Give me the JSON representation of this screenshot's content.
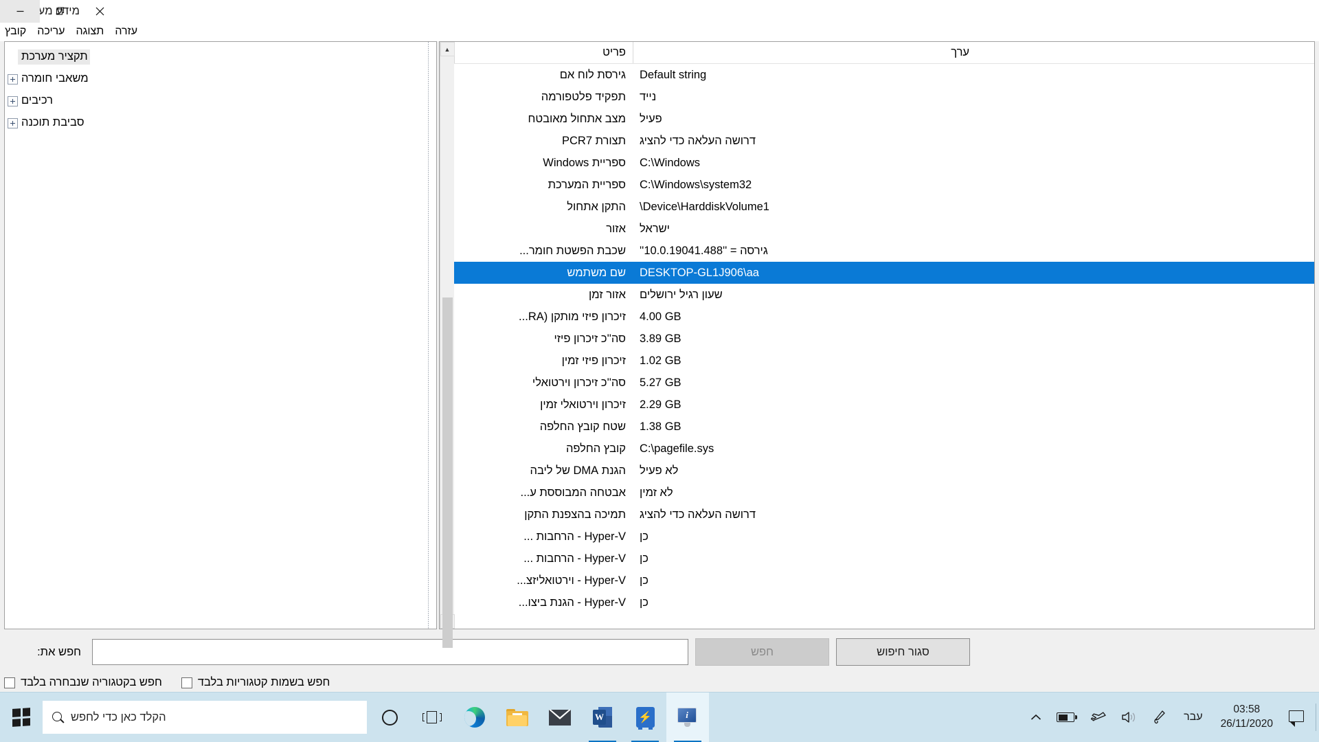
{
  "window": {
    "title": "מידע מערכת",
    "icon": "system-information-icon",
    "controls": {
      "minimize": "–",
      "maximize": "❐",
      "close": "✕"
    }
  },
  "menubar": {
    "items": [
      {
        "label": "קובץ"
      },
      {
        "label": "עריכה"
      },
      {
        "label": "תצוגה"
      },
      {
        "label": "עזרה"
      }
    ]
  },
  "tree": {
    "items": [
      {
        "label": "תקציר מערכת",
        "expandable": false,
        "selected": true
      },
      {
        "label": "משאבי חומרה",
        "expandable": true,
        "selected": false
      },
      {
        "label": "רכיבים",
        "expandable": true,
        "selected": false
      },
      {
        "label": "סביבת תוכנה",
        "expandable": true,
        "selected": false
      }
    ]
  },
  "detail": {
    "headers": {
      "item": "פריט",
      "value": "ערך"
    },
    "rows": [
      {
        "item": "גירסת לוח אם",
        "value": "Default string",
        "dir": "ltr",
        "selected": false
      },
      {
        "item": "תפקיד פלטפורמה",
        "value": "נייד",
        "dir": "rtl",
        "selected": false
      },
      {
        "item": "מצב אתחול מאובטח",
        "value": "פעיל",
        "dir": "rtl",
        "selected": false
      },
      {
        "item": "תצורת PCR7",
        "value": "דרושה העלאה כדי להציג",
        "dir": "rtl",
        "selected": false
      },
      {
        "item": "ספריית Windows",
        "value": "C:\\Windows",
        "dir": "ltr",
        "selected": false
      },
      {
        "item": "ספריית המערכת",
        "value": "C:\\Windows\\system32",
        "dir": "ltr",
        "selected": false
      },
      {
        "item": "התקן אתחול",
        "value": "\\Device\\HarddiskVolume1",
        "dir": "ltr",
        "selected": false
      },
      {
        "item": "אזור",
        "value": "ישראל",
        "dir": "rtl",
        "selected": false
      },
      {
        "item": "שכבת הפשטת חומר...",
        "value": "גירסה = ''10.0.19041.488''",
        "dir": "rtl",
        "selected": false
      },
      {
        "item": "שם משתמש",
        "value": "DESKTOP-GL1J906\\aa",
        "dir": "ltr",
        "selected": true
      },
      {
        "item": "אזור זמן",
        "value": "שעון רגיל ירושלים",
        "dir": "rtl",
        "selected": false
      },
      {
        "item": "זיכרון פיזי מותקן (RA...",
        "value": "4.00 GB",
        "dir": "ltr",
        "selected": false
      },
      {
        "item": "סה''כ זיכרון פיזי",
        "value": "3.89 GB",
        "dir": "ltr",
        "selected": false
      },
      {
        "item": "זיכרון פיזי זמין",
        "value": "1.02 GB",
        "dir": "ltr",
        "selected": false
      },
      {
        "item": "סה''כ זיכרון וירטואלי",
        "value": "5.27 GB",
        "dir": "ltr",
        "selected": false
      },
      {
        "item": "זיכרון וירטואלי זמין",
        "value": "2.29 GB",
        "dir": "ltr",
        "selected": false
      },
      {
        "item": "שטח קובץ החלפה",
        "value": "1.38 GB",
        "dir": "ltr",
        "selected": false
      },
      {
        "item": "קובץ החלפה",
        "value": "C:\\pagefile.sys",
        "dir": "ltr",
        "selected": false
      },
      {
        "item": "הגנת DMA של ליבה",
        "value": "לא פעיל",
        "dir": "rtl",
        "selected": false
      },
      {
        "item": "אבטחה המבוססת ע...",
        "value": "לא זמין",
        "dir": "rtl",
        "selected": false
      },
      {
        "item": "תמיכה בהצפנת התקן",
        "value": "דרושה העלאה כדי להציג",
        "dir": "rtl",
        "selected": false
      },
      {
        "item": "Hyper-V - הרחבות ...",
        "value": "כן",
        "dir": "rtl",
        "selected": false
      },
      {
        "item": "Hyper-V - הרחבות ...",
        "value": "כן",
        "dir": "rtl",
        "selected": false
      },
      {
        "item": "Hyper-V - וירטואליזצ...",
        "value": "כן",
        "dir": "rtl",
        "selected": false
      },
      {
        "item": "Hyper-V - הגנת ביצו...",
        "value": "כן",
        "dir": "rtl",
        "selected": false
      }
    ]
  },
  "search": {
    "label": "חפש את:",
    "input_value": "",
    "input_placeholder": "",
    "find_button": "חפש",
    "close_button": "סגור חיפוש",
    "checkbox_selected_category": "חפש בקטגוריה שנבחרה בלבד",
    "checkbox_category_names": "חפש בשמות קטגוריות בלבד"
  },
  "taskbar": {
    "start_icon": "windows-logo-icon",
    "search_placeholder": "הקלד כאן כדי לחפש",
    "search_icon": "search-icon",
    "items": [
      {
        "name": "cortana-icon",
        "label": "Cortana"
      },
      {
        "name": "task-view-icon",
        "label": "תצוגת משימות"
      },
      {
        "name": "edge-icon",
        "label": "Microsoft Edge"
      },
      {
        "name": "file-explorer-icon",
        "label": "סייר הקבצים"
      },
      {
        "name": "mail-icon",
        "label": "דואר"
      },
      {
        "name": "word-icon",
        "label": "Word"
      },
      {
        "name": "blue-app-icon",
        "label": "Zoom"
      },
      {
        "name": "system-information-icon",
        "label": "מידע מערכת"
      }
    ],
    "tray": {
      "chevron": "chevron-up-icon",
      "battery": "battery-icon",
      "airplane": "airplane-mode-icon",
      "volume": "speaker-icon",
      "pen": "pen-icon",
      "language": "עבר",
      "time": "03:58",
      "date": "26/11/2020",
      "notifications": "notification-icon"
    }
  },
  "colors": {
    "selection_blue": "#0a7ad6",
    "taskbar_bg": "#cde3ee",
    "window_bg": "#f0f0f0"
  }
}
